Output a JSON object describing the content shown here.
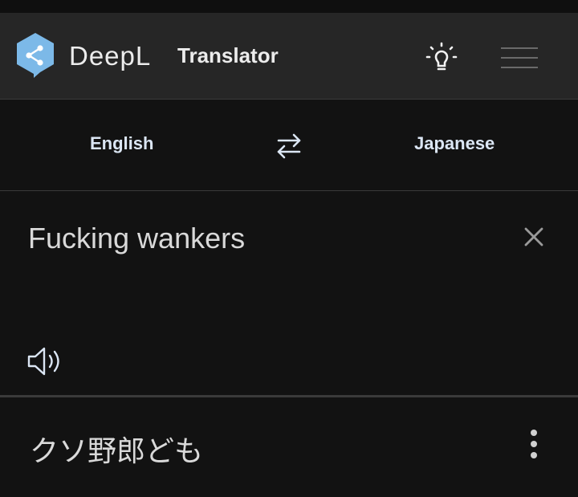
{
  "header": {
    "brand": "DeepL",
    "product": "Translator",
    "icons": {
      "logo": "deepl-logo-icon",
      "tips": "lightbulb-icon",
      "menu": "hamburger-menu-icon"
    }
  },
  "languages": {
    "source": "English",
    "target": "Japanese",
    "swap_icon": "swap-arrows-icon"
  },
  "source": {
    "text": "Fucking wankers",
    "clear_icon": "close-icon",
    "speak_icon": "speaker-icon"
  },
  "target": {
    "text": "クソ野郎ども",
    "more_icon": "more-vertical-icon"
  },
  "colors": {
    "background": "#121212",
    "header_bg": "#262626",
    "logo_accent": "#7cb9e8",
    "language_text": "#dbe6f4",
    "divider": "#3a3a3a"
  }
}
